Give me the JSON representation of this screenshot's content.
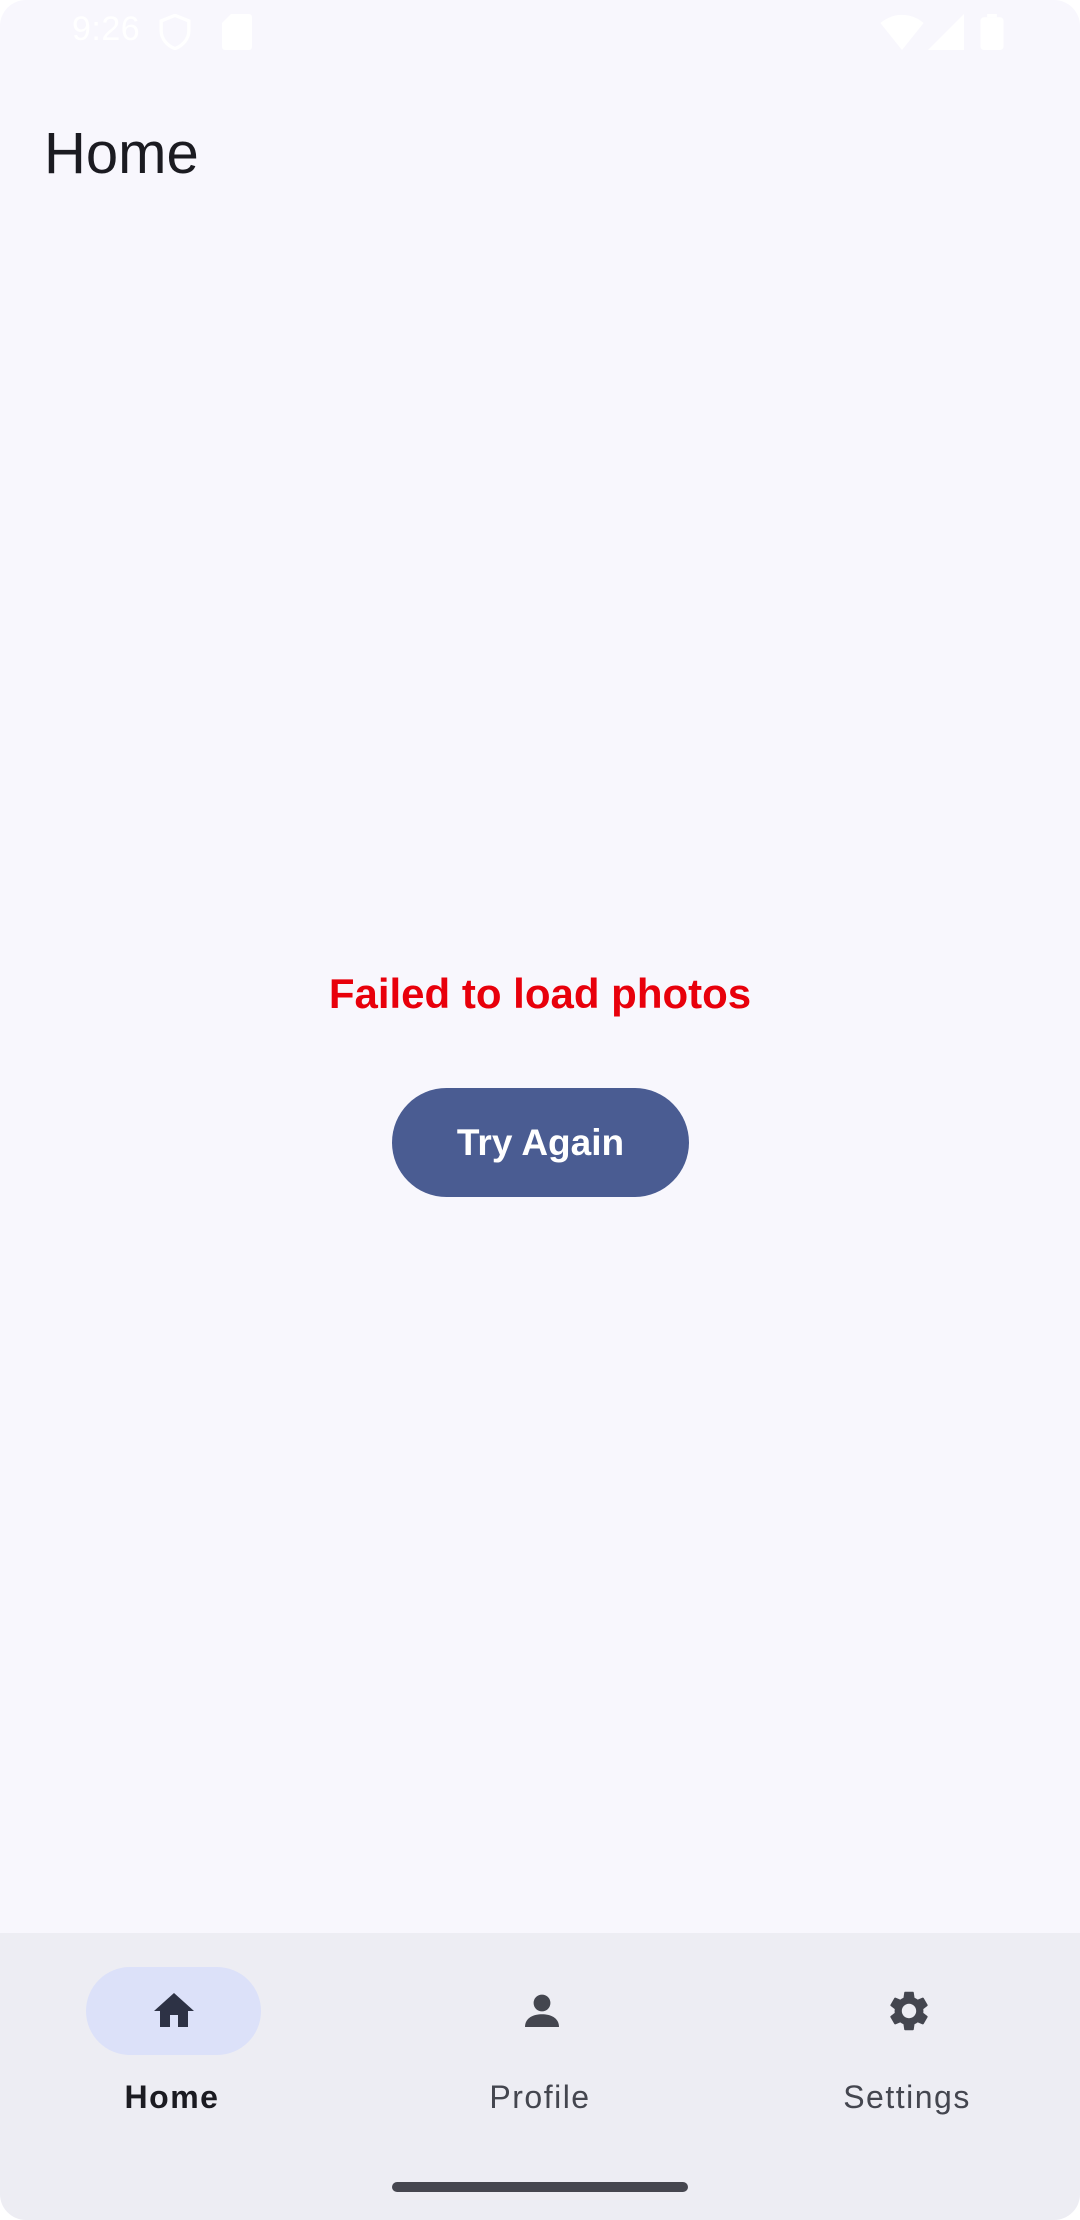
{
  "status_bar": {
    "time": "9:26",
    "icons": [
      "shield-icon",
      "sim-card-icon",
      "wifi-icon",
      "signal-icon",
      "battery-icon"
    ]
  },
  "top_bar": {
    "title": "Home"
  },
  "main": {
    "error_message": "Failed to load photos",
    "retry_label": "Try Again"
  },
  "bottom_nav": {
    "items": [
      {
        "label": "Home",
        "icon": "home-icon",
        "selected": true
      },
      {
        "label": "Profile",
        "icon": "person-icon",
        "selected": false
      },
      {
        "label": "Settings",
        "icon": "gear-icon",
        "selected": false
      }
    ]
  },
  "colors": {
    "background": "#f8f7fd",
    "primary": "#4a5c92",
    "error": "#e8000b",
    "nav_background": "#ededf3",
    "nav_indicator": "#dce1f9",
    "on_surface": "#1b1b21"
  }
}
